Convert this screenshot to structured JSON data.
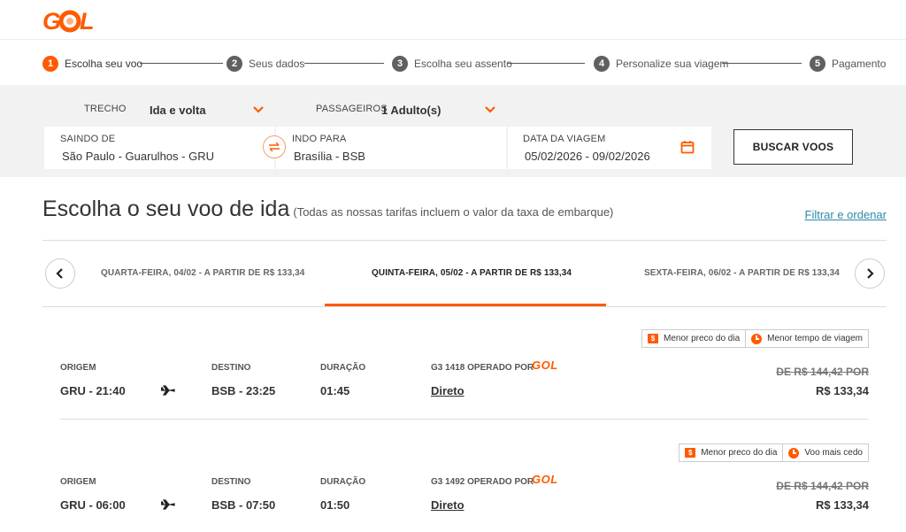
{
  "brand": {
    "logo_text": "GOL",
    "accent": "#ff5a00"
  },
  "stepper": {
    "steps": [
      {
        "num": "1",
        "label": "Escolha seu voo",
        "active": true
      },
      {
        "num": "2",
        "label": "Seus dados",
        "active": false
      },
      {
        "num": "3",
        "label": "Escolha seu assento",
        "active": false
      },
      {
        "num": "4",
        "label": "Personalize sua viagem",
        "active": false
      },
      {
        "num": "5",
        "label": "Pagamento",
        "active": false
      }
    ]
  },
  "search": {
    "trecho_label": "TRECHO",
    "trecho_value": "Ida e volta",
    "passageiros_label": "PASSAGEIROS",
    "passageiros_value": "1 Adulto(s)",
    "origin_label": "SAINDO DE",
    "origin_value": "São Paulo  -  Guarulhos - GRU",
    "destination_label": "INDO PARA",
    "destination_value": "Brasília - BSB",
    "date_label": "DATA DA VIAGEM",
    "date_value": "05/02/2026  -  09/02/2026",
    "button_label": "BUSCAR VOOS"
  },
  "results": {
    "title": "Escolha o seu voo de ida",
    "subtitle": "(Todas as nossas tarifas incluem o valor da taxa de embarque)",
    "filter_link": "Filtrar e ordenar"
  },
  "date_tabs": [
    {
      "label": "QUARTA-FEIRA, 04/02 - A PARTIR DE R$ 133,34",
      "active": false
    },
    {
      "label": "QUINTA-FEIRA, 05/02 - A PARTIR DE R$ 133,34",
      "active": true
    },
    {
      "label": "SEXTA-FEIRA, 06/02 - A PARTIR DE R$ 133,34",
      "active": false
    }
  ],
  "columns": {
    "origin": "ORIGEM",
    "destination": "DESTINO",
    "duration": "DURAÇÃO"
  },
  "flights": [
    {
      "badges": [
        {
          "icon": "dollar-icon",
          "label": "Menor preco do dia"
        },
        {
          "icon": "clock-icon",
          "label": "Menor tempo de viagem"
        }
      ],
      "origin": "GRU - 21:40",
      "destination": "BSB - 23:25",
      "duration": "01:45",
      "operated_by": "G3 1418 OPERADO POR",
      "operator_logo": "GOL",
      "stops": "Direto",
      "old_price": "DE R$ 144,42 POR",
      "price": "R$ 133,34"
    },
    {
      "badges": [
        {
          "icon": "dollar-icon",
          "label": "Menor preco do dia"
        },
        {
          "icon": "clock-icon",
          "label": "Voo mais cedo"
        }
      ],
      "origin": "GRU - 06:00",
      "destination": "BSB - 07:50",
      "duration": "01:50",
      "operated_by": "G3 1492 OPERADO POR",
      "operator_logo": "GOL",
      "stops": "Direto",
      "old_price": "DE R$ 144,42 POR",
      "price": "R$ 133,34"
    }
  ]
}
